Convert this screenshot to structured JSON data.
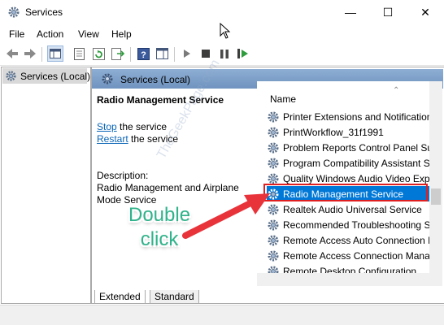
{
  "window": {
    "title": "Services",
    "minimize": "—",
    "maximize": "☐",
    "close": "✕"
  },
  "menu": {
    "file": "File",
    "action": "Action",
    "view": "View",
    "help": "Help"
  },
  "tree": {
    "root_label": "Services (Local)"
  },
  "pane": {
    "header": "Services (Local)",
    "service_name": "Radio Management Service",
    "stop_link": "Stop",
    "stop_suffix": " the service",
    "restart_link": "Restart",
    "restart_suffix": " the service",
    "description_label": "Description:",
    "description_lines": [
      "Radio Management and Airplane",
      "Mode Service"
    ]
  },
  "list": {
    "column_name": "Name",
    "rows": [
      "Printer Extensions and Notifications",
      "PrintWorkflow_31f1991",
      "Problem Reports Control Panel Support",
      "Program Compatibility Assistant Service",
      "Quality Windows Audio Video Experience",
      "Radio Management Service",
      "Realtek Audio Universal Service",
      "Recommended Troubleshooting Service",
      "Remote Access Auto Connection Manager",
      "Remote Access Connection Manager",
      "Remote Desktop Configuration"
    ],
    "selected_index": 5
  },
  "tabs": {
    "extended": "Extended",
    "standard": "Standard"
  },
  "annotation": {
    "line1": "Double",
    "line2": "click"
  },
  "watermark": "TheGeekPage.com",
  "colors": {
    "selection": "#0078d7",
    "highlight_box": "#e02020",
    "annotation_text": "#2fb38a",
    "arrow": "#e8333a",
    "header_bar": "#7b9cc6"
  }
}
